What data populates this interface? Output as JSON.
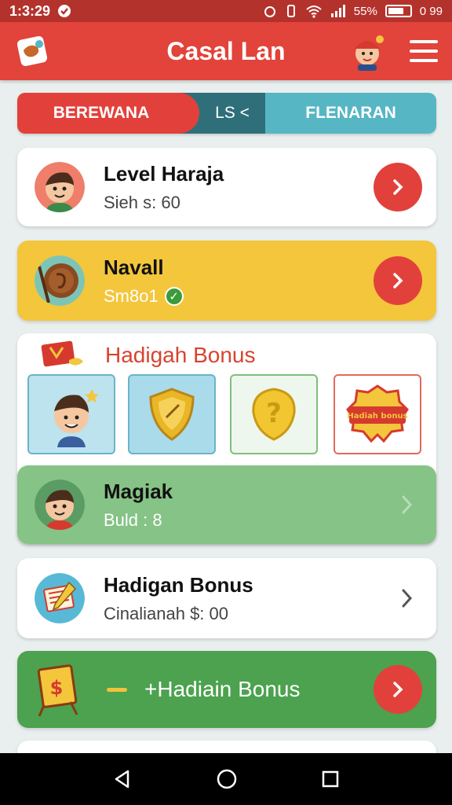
{
  "status_bar": {
    "time": "1:3:29",
    "battery_text": "0 99",
    "signal_text": "55%"
  },
  "app_bar": {
    "title": "Casal Lan"
  },
  "tabs": [
    {
      "label": "BEREWANA"
    },
    {
      "label": "LS <"
    },
    {
      "label": "FLENARAN"
    }
  ],
  "cards": {
    "level": {
      "title": "Level Haraja",
      "subtitle": "Sieh s: 60"
    },
    "navall": {
      "title": "Navall",
      "subtitle": "Sm8o1"
    },
    "bonus_panel": {
      "title": "Hadigah Bonus",
      "ribbon_text": "Hadiah bonus"
    },
    "magiak": {
      "title": "Magiak",
      "subtitle": "Buld  :  8"
    },
    "hadigan": {
      "title": "Hadigan Bonus",
      "subtitle": "Cinalianah $: 00"
    },
    "cta": {
      "label": "+Hadiain Bonus"
    }
  },
  "colors": {
    "primary_red": "#e2433a",
    "yellow": "#f3c63c",
    "green": "#4ca24e",
    "light_green": "#86c386",
    "teal": "#56b6c4"
  }
}
